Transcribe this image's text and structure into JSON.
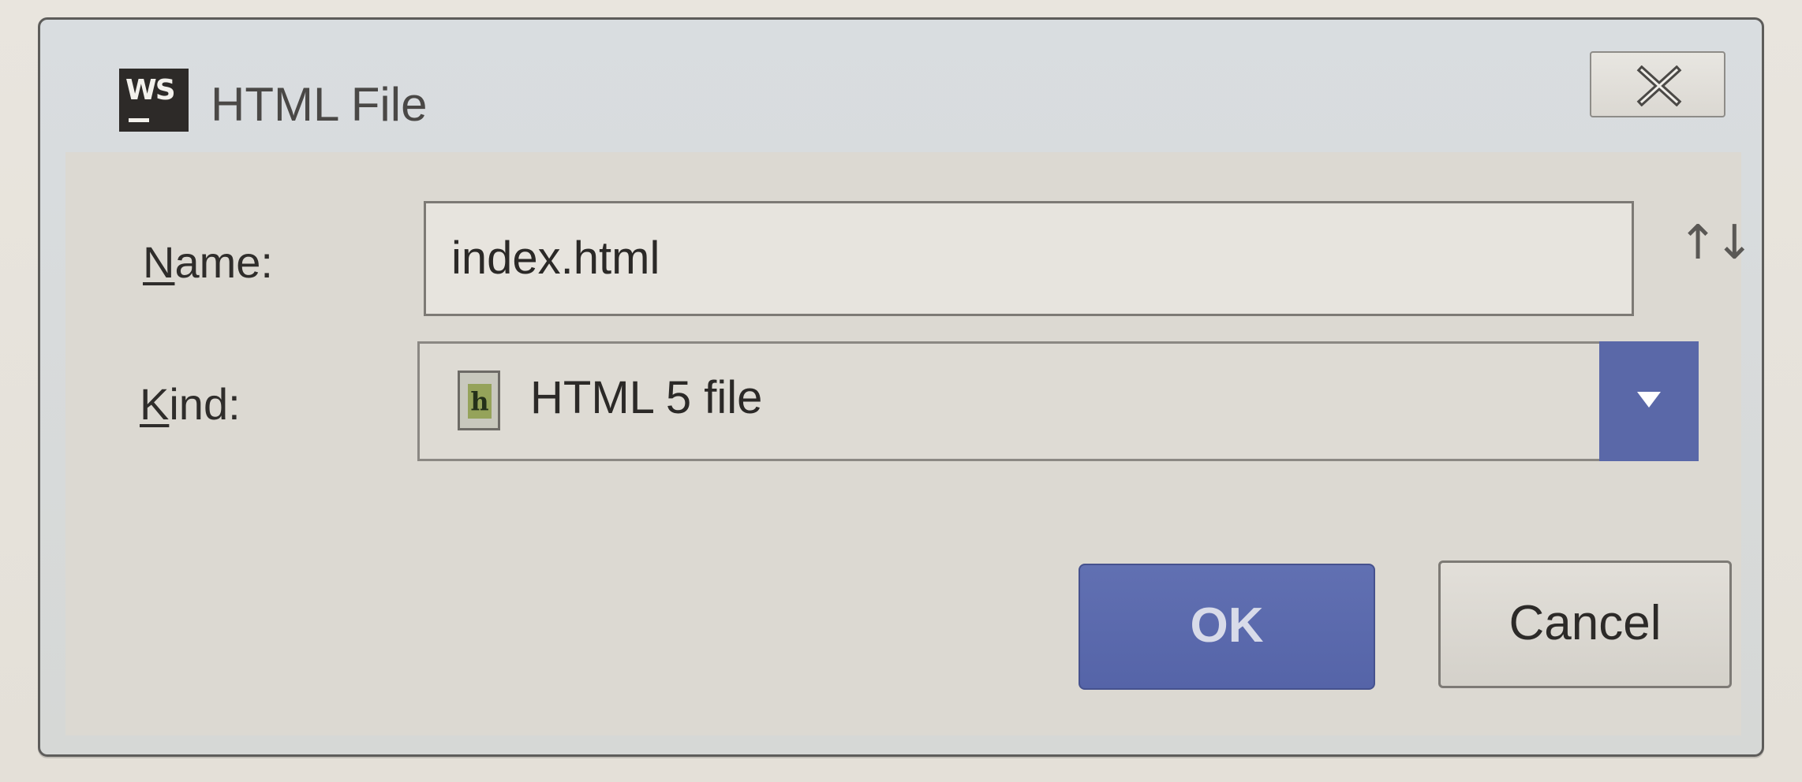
{
  "dialog": {
    "title": "HTML File",
    "app_icon_text": "WS",
    "close_icon": "close-icon"
  },
  "form": {
    "name_label_mnemonic": "N",
    "name_label_rest": "ame:",
    "name_value": "index.html",
    "sort_icon_text": "↑↓",
    "kind_label_mnemonic": "K",
    "kind_label_rest": "ind:",
    "kind_value": "HTML 5 file",
    "kind_icon": "html-file-icon",
    "kind_icon_glyph": "h"
  },
  "buttons": {
    "ok_label": "OK",
    "cancel_label": "Cancel"
  },
  "colors": {
    "accent": "#5a68a8",
    "dialog_background": "#dcd9d2"
  }
}
